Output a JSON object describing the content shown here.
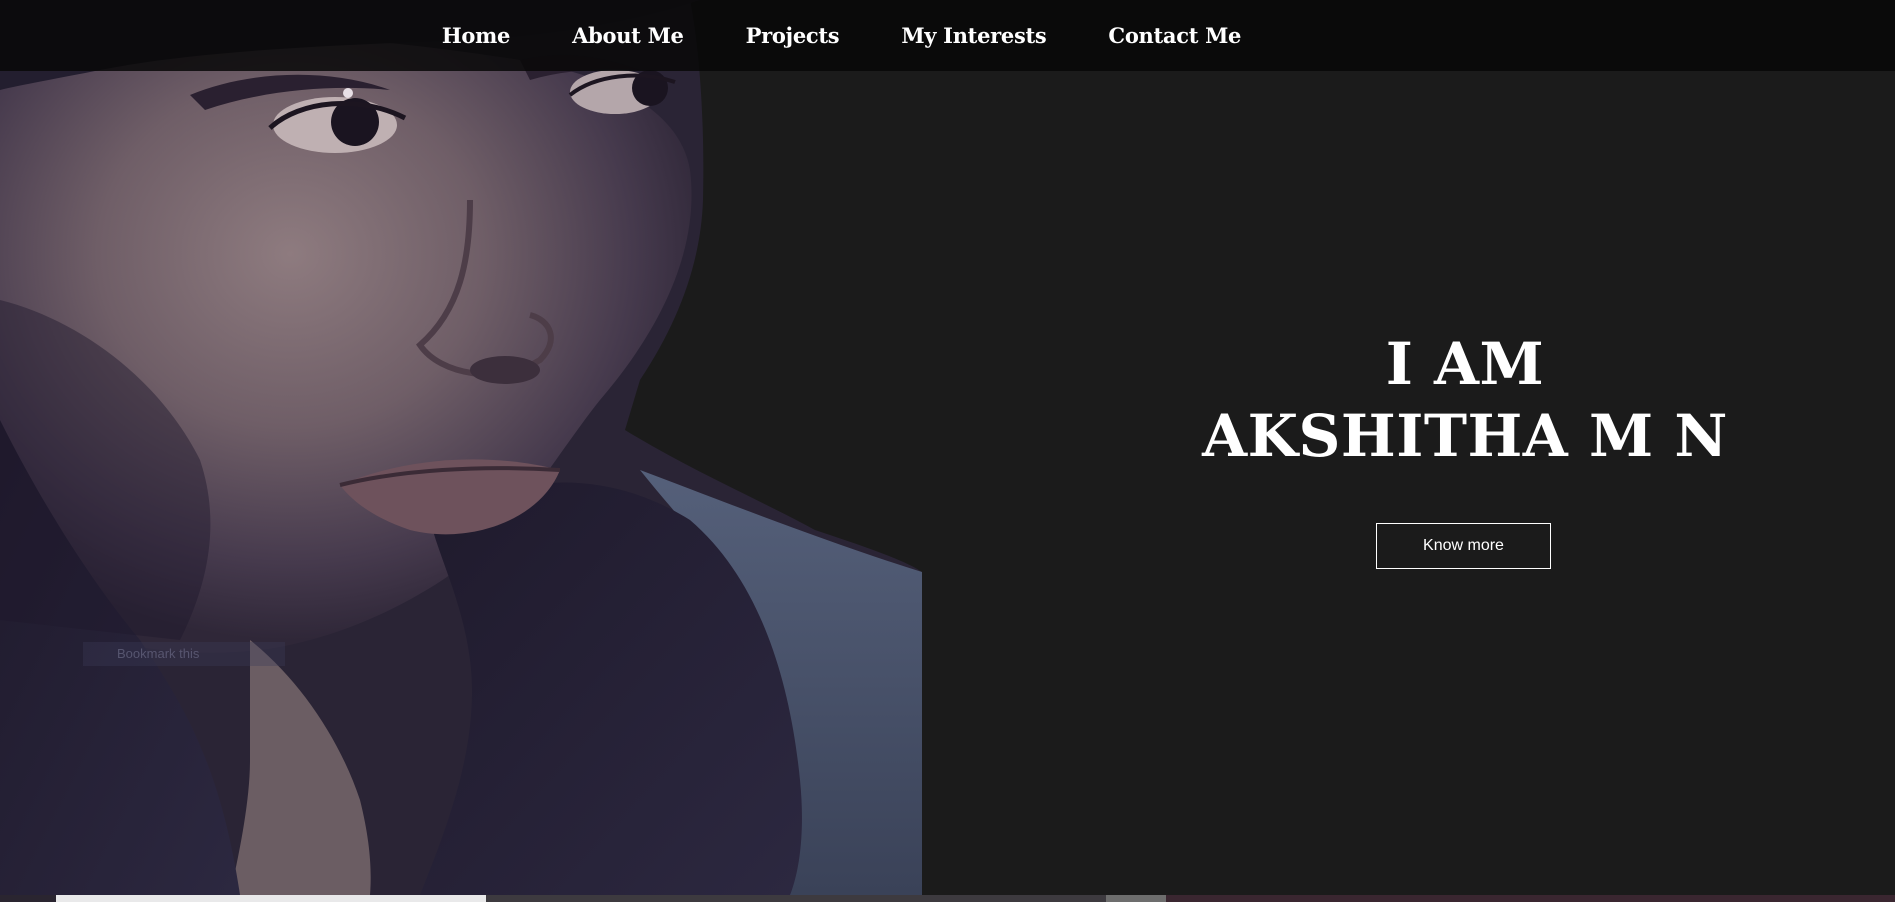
{
  "nav": {
    "items": [
      {
        "label": "Home"
      },
      {
        "label": "About Me"
      },
      {
        "label": "Projects"
      },
      {
        "label": "My Interests"
      },
      {
        "label": "Contact Me"
      }
    ]
  },
  "hero": {
    "line1": "I AM",
    "line2": "AKSHITHA M N",
    "button_label": "Know more"
  },
  "photo": {
    "caption": "Bookmark this"
  },
  "colors": {
    "page_background": "#1b1b1b",
    "nav_background": "#0b0b0b",
    "text": "#ffffff",
    "button_border": "#ffffff"
  }
}
